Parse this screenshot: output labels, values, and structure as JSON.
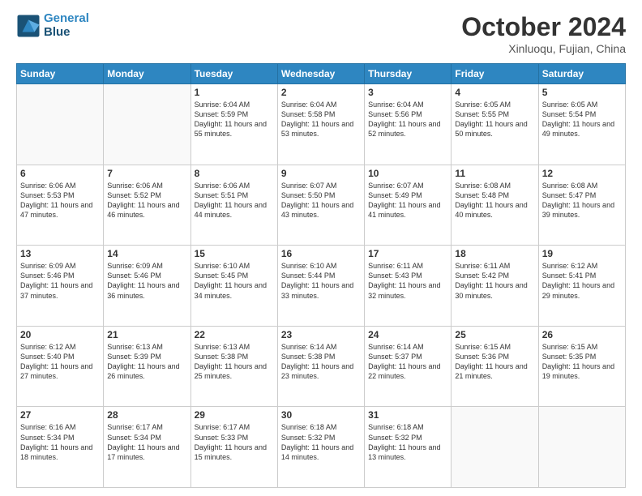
{
  "header": {
    "logo_line1": "General",
    "logo_line2": "Blue",
    "month_title": "October 2024",
    "location": "Xinluoqu, Fujian, China"
  },
  "weekdays": [
    "Sunday",
    "Monday",
    "Tuesday",
    "Wednesday",
    "Thursday",
    "Friday",
    "Saturday"
  ],
  "weeks": [
    [
      {
        "day": "",
        "info": ""
      },
      {
        "day": "",
        "info": ""
      },
      {
        "day": "1",
        "info": "Sunrise: 6:04 AM\nSunset: 5:59 PM\nDaylight: 11 hours and 55 minutes."
      },
      {
        "day": "2",
        "info": "Sunrise: 6:04 AM\nSunset: 5:58 PM\nDaylight: 11 hours and 53 minutes."
      },
      {
        "day": "3",
        "info": "Sunrise: 6:04 AM\nSunset: 5:56 PM\nDaylight: 11 hours and 52 minutes."
      },
      {
        "day": "4",
        "info": "Sunrise: 6:05 AM\nSunset: 5:55 PM\nDaylight: 11 hours and 50 minutes."
      },
      {
        "day": "5",
        "info": "Sunrise: 6:05 AM\nSunset: 5:54 PM\nDaylight: 11 hours and 49 minutes."
      }
    ],
    [
      {
        "day": "6",
        "info": "Sunrise: 6:06 AM\nSunset: 5:53 PM\nDaylight: 11 hours and 47 minutes."
      },
      {
        "day": "7",
        "info": "Sunrise: 6:06 AM\nSunset: 5:52 PM\nDaylight: 11 hours and 46 minutes."
      },
      {
        "day": "8",
        "info": "Sunrise: 6:06 AM\nSunset: 5:51 PM\nDaylight: 11 hours and 44 minutes."
      },
      {
        "day": "9",
        "info": "Sunrise: 6:07 AM\nSunset: 5:50 PM\nDaylight: 11 hours and 43 minutes."
      },
      {
        "day": "10",
        "info": "Sunrise: 6:07 AM\nSunset: 5:49 PM\nDaylight: 11 hours and 41 minutes."
      },
      {
        "day": "11",
        "info": "Sunrise: 6:08 AM\nSunset: 5:48 PM\nDaylight: 11 hours and 40 minutes."
      },
      {
        "day": "12",
        "info": "Sunrise: 6:08 AM\nSunset: 5:47 PM\nDaylight: 11 hours and 39 minutes."
      }
    ],
    [
      {
        "day": "13",
        "info": "Sunrise: 6:09 AM\nSunset: 5:46 PM\nDaylight: 11 hours and 37 minutes."
      },
      {
        "day": "14",
        "info": "Sunrise: 6:09 AM\nSunset: 5:46 PM\nDaylight: 11 hours and 36 minutes."
      },
      {
        "day": "15",
        "info": "Sunrise: 6:10 AM\nSunset: 5:45 PM\nDaylight: 11 hours and 34 minutes."
      },
      {
        "day": "16",
        "info": "Sunrise: 6:10 AM\nSunset: 5:44 PM\nDaylight: 11 hours and 33 minutes."
      },
      {
        "day": "17",
        "info": "Sunrise: 6:11 AM\nSunset: 5:43 PM\nDaylight: 11 hours and 32 minutes."
      },
      {
        "day": "18",
        "info": "Sunrise: 6:11 AM\nSunset: 5:42 PM\nDaylight: 11 hours and 30 minutes."
      },
      {
        "day": "19",
        "info": "Sunrise: 6:12 AM\nSunset: 5:41 PM\nDaylight: 11 hours and 29 minutes."
      }
    ],
    [
      {
        "day": "20",
        "info": "Sunrise: 6:12 AM\nSunset: 5:40 PM\nDaylight: 11 hours and 27 minutes."
      },
      {
        "day": "21",
        "info": "Sunrise: 6:13 AM\nSunset: 5:39 PM\nDaylight: 11 hours and 26 minutes."
      },
      {
        "day": "22",
        "info": "Sunrise: 6:13 AM\nSunset: 5:38 PM\nDaylight: 11 hours and 25 minutes."
      },
      {
        "day": "23",
        "info": "Sunrise: 6:14 AM\nSunset: 5:38 PM\nDaylight: 11 hours and 23 minutes."
      },
      {
        "day": "24",
        "info": "Sunrise: 6:14 AM\nSunset: 5:37 PM\nDaylight: 11 hours and 22 minutes."
      },
      {
        "day": "25",
        "info": "Sunrise: 6:15 AM\nSunset: 5:36 PM\nDaylight: 11 hours and 21 minutes."
      },
      {
        "day": "26",
        "info": "Sunrise: 6:15 AM\nSunset: 5:35 PM\nDaylight: 11 hours and 19 minutes."
      }
    ],
    [
      {
        "day": "27",
        "info": "Sunrise: 6:16 AM\nSunset: 5:34 PM\nDaylight: 11 hours and 18 minutes."
      },
      {
        "day": "28",
        "info": "Sunrise: 6:17 AM\nSunset: 5:34 PM\nDaylight: 11 hours and 17 minutes."
      },
      {
        "day": "29",
        "info": "Sunrise: 6:17 AM\nSunset: 5:33 PM\nDaylight: 11 hours and 15 minutes."
      },
      {
        "day": "30",
        "info": "Sunrise: 6:18 AM\nSunset: 5:32 PM\nDaylight: 11 hours and 14 minutes."
      },
      {
        "day": "31",
        "info": "Sunrise: 6:18 AM\nSunset: 5:32 PM\nDaylight: 11 hours and 13 minutes."
      },
      {
        "day": "",
        "info": ""
      },
      {
        "day": "",
        "info": ""
      }
    ]
  ]
}
